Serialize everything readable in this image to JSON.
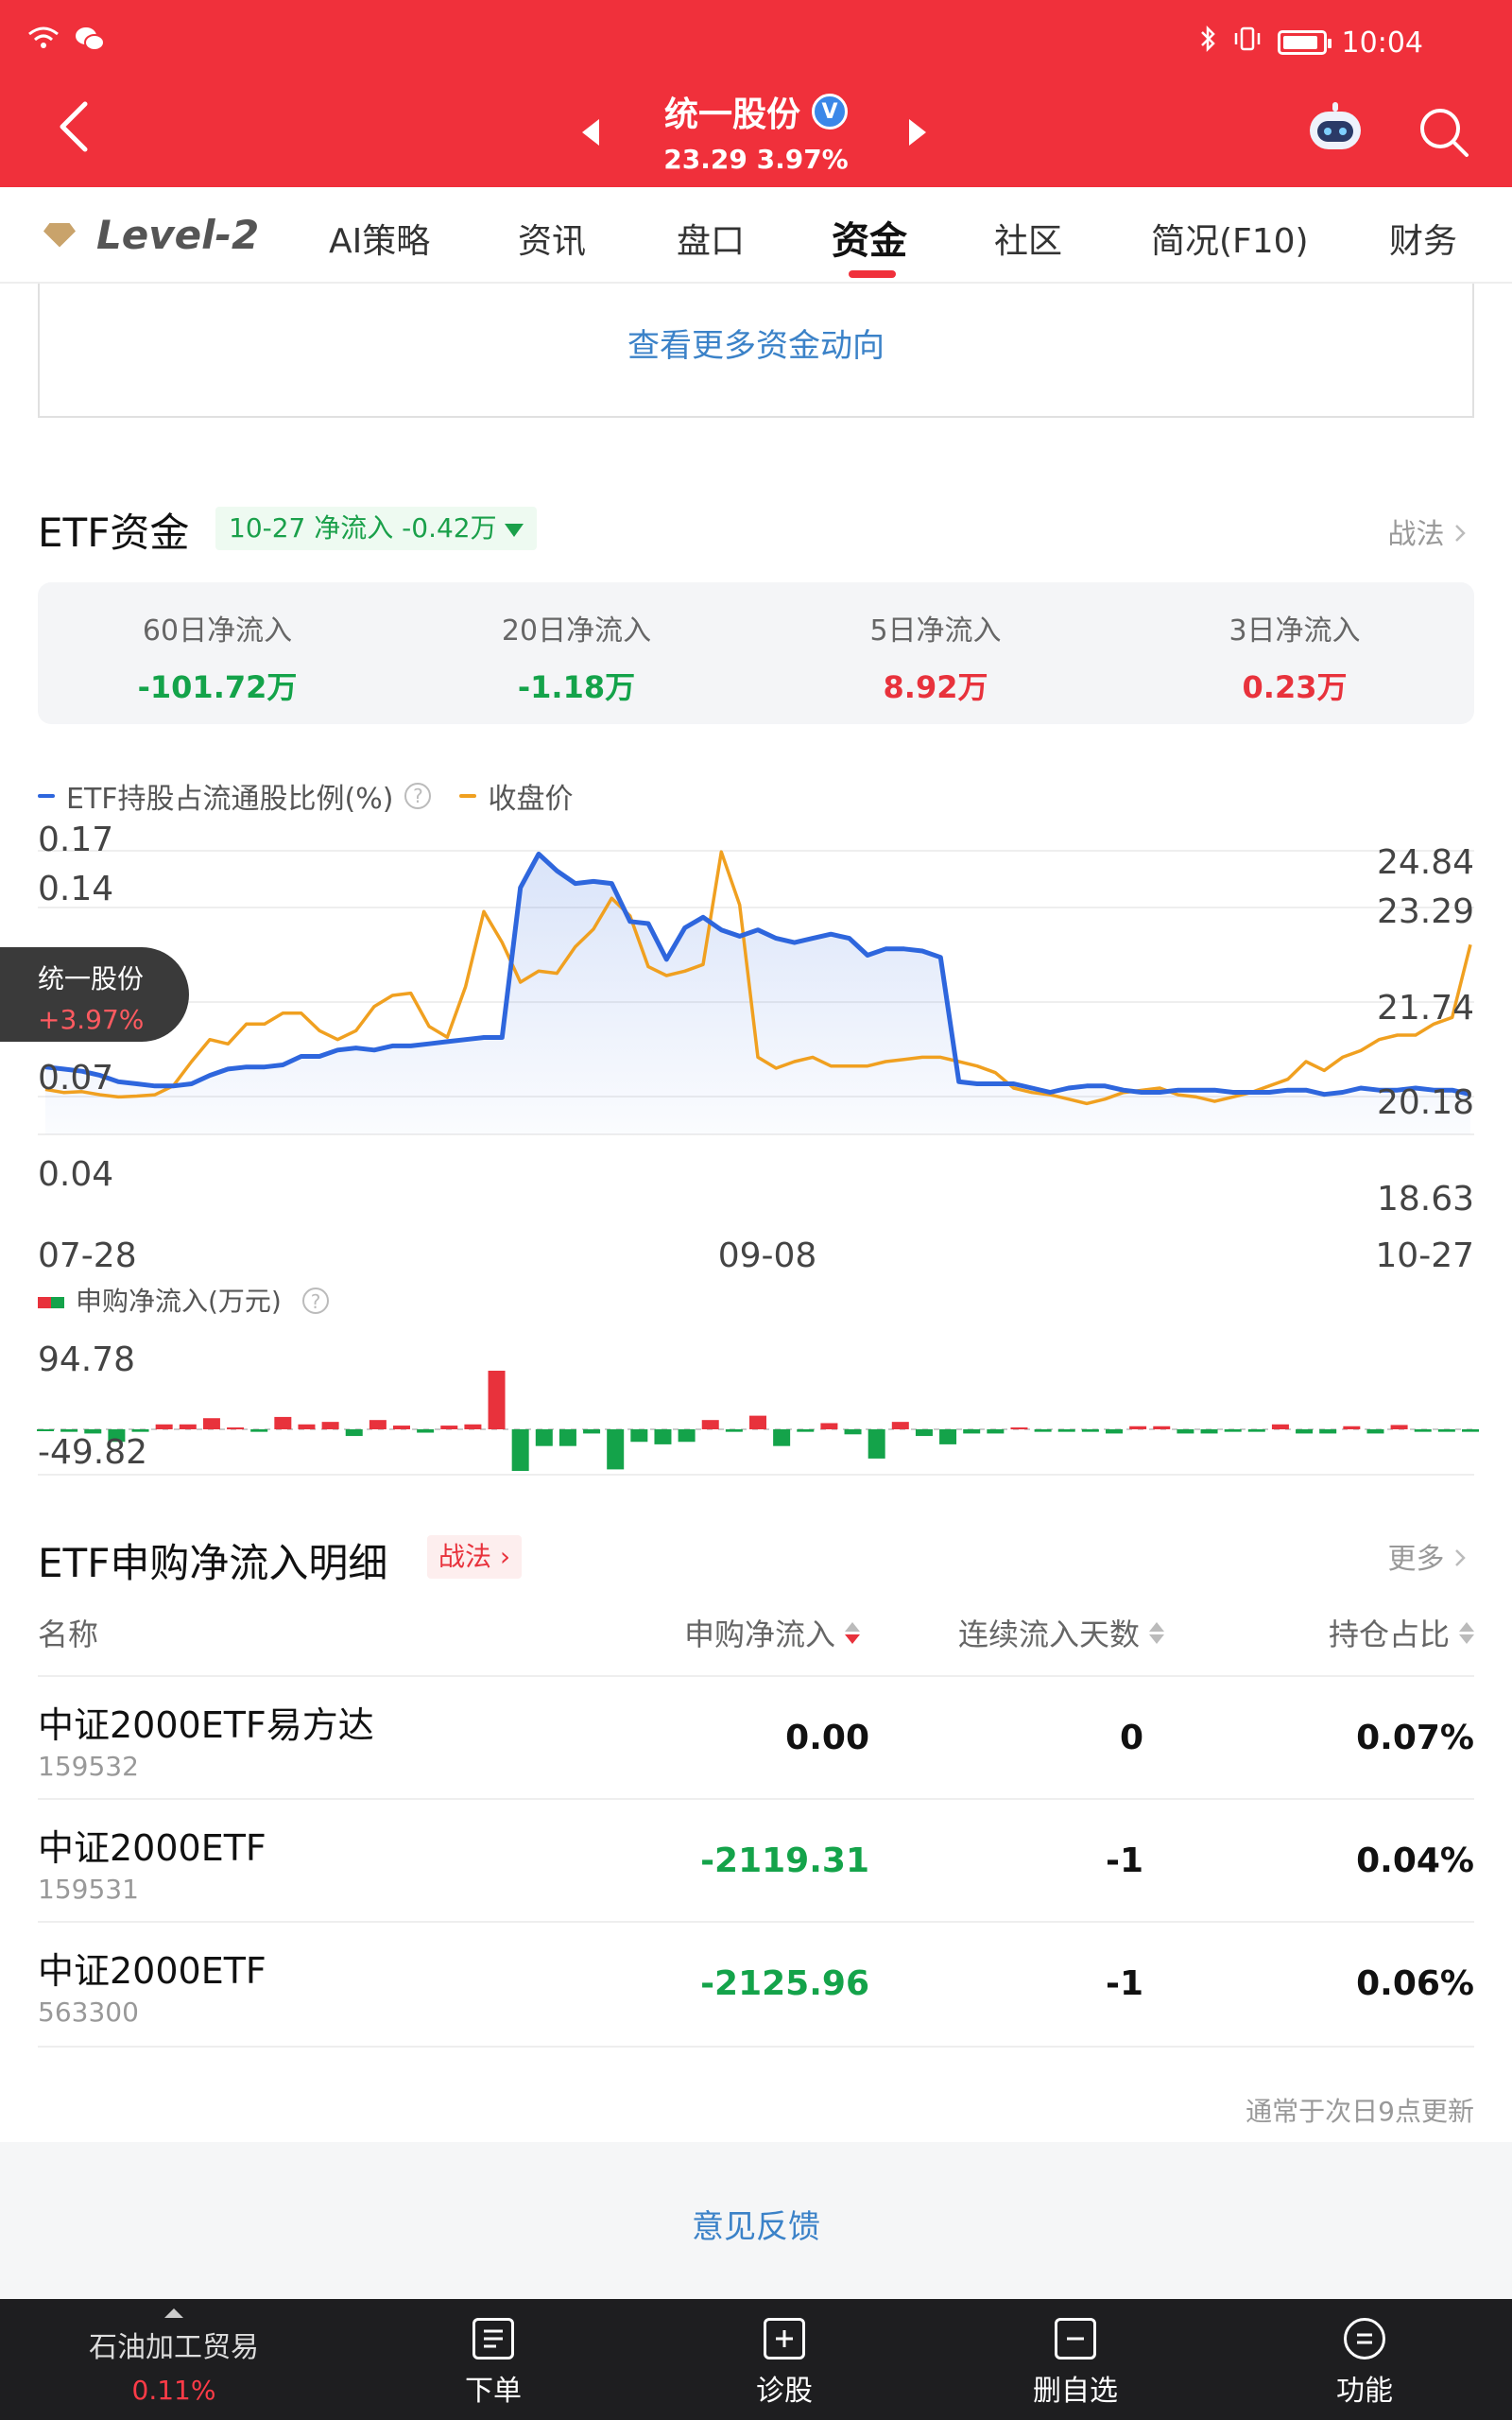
{
  "status": {
    "time": "10:04"
  },
  "header": {
    "title": "统一股份",
    "verified_badge": "V",
    "price": "23.29",
    "change": "3.97%"
  },
  "tabs": [
    {
      "label": "Level-2"
    },
    {
      "label": "AI策略"
    },
    {
      "label": "资讯"
    },
    {
      "label": "盘口"
    },
    {
      "label": "资金",
      "active": true
    },
    {
      "label": "社区"
    },
    {
      "label": "简况(F10)"
    },
    {
      "label": "财务"
    }
  ],
  "top_link": "查看更多资金动向",
  "etf": {
    "title": "ETF资金",
    "tag": "10-27 净流入 -0.42万",
    "strategy_link": "战法",
    "stats": [
      {
        "label": "60日净流入",
        "value": "-101.72万",
        "dir": "down"
      },
      {
        "label": "20日净流入",
        "value": "-1.18万",
        "dir": "down"
      },
      {
        "label": "5日净流入",
        "value": "8.92万",
        "dir": "up"
      },
      {
        "label": "3日净流入",
        "value": "0.23万",
        "dir": "up"
      }
    ]
  },
  "overlay": {
    "name": "统一股份",
    "change": "+3.97%"
  },
  "colors": {
    "brand_red": "#f0303b",
    "up": "#e8323c",
    "down": "#14a34a",
    "blue_series": "#2e66dd",
    "orange_series": "#f0a020",
    "link_blue": "#3b82c8"
  },
  "chart_data": [
    {
      "type": "line",
      "legend": [
        "ETF持股占流通股比例(%)",
        "收盘价"
      ],
      "x_labels": [
        "07-28",
        "09-08",
        "10-27"
      ],
      "y_left_ticks": [
        "0.17",
        "0.14",
        "0.07",
        "0.04"
      ],
      "y_right_ticks": [
        "24.84",
        "23.29",
        "21.74",
        "20.18",
        "18.63"
      ],
      "y_left_range": [
        0.04,
        0.17
      ],
      "y_right_range": [
        18.63,
        24.84
      ],
      "series": [
        {
          "name": "ETF持股占流通股比例(%)",
          "axis": "left",
          "values": [
            0.063,
            0.062,
            0.061,
            0.059,
            0.056,
            0.055,
            0.054,
            0.054,
            0.055,
            0.059,
            0.062,
            0.063,
            0.063,
            0.064,
            0.068,
            0.068,
            0.071,
            0.072,
            0.071,
            0.073,
            0.073,
            0.074,
            0.075,
            0.076,
            0.077,
            0.077,
            0.148,
            0.164,
            0.156,
            0.15,
            0.151,
            0.15,
            0.132,
            0.131,
            0.114,
            0.129,
            0.134,
            0.128,
            0.125,
            0.128,
            0.124,
            0.122,
            0.124,
            0.126,
            0.124,
            0.116,
            0.119,
            0.119,
            0.118,
            0.115,
            0.056,
            0.055,
            0.055,
            0.055,
            0.053,
            0.051,
            0.053,
            0.054,
            0.054,
            0.052,
            0.051,
            0.051,
            0.052,
            0.052,
            0.052,
            0.051,
            0.051,
            0.051,
            0.052,
            0.052,
            0.05,
            0.051,
            0.053,
            0.052,
            0.052,
            0.053,
            0.052,
            0.052,
            0.05
          ]
        },
        {
          "name": "收盘价",
          "axis": "right",
          "values": [
            19.22,
            19.15,
            19.17,
            19.1,
            19.05,
            19.07,
            19.1,
            19.3,
            19.85,
            20.35,
            20.25,
            20.7,
            20.7,
            20.95,
            20.95,
            20.55,
            20.35,
            20.55,
            21.1,
            21.35,
            21.4,
            20.65,
            20.4,
            21.55,
            23.25,
            22.55,
            21.65,
            21.9,
            21.85,
            22.45,
            22.85,
            23.55,
            23.15,
            22.0,
            21.8,
            21.9,
            22.05,
            24.6,
            23.4,
            19.95,
            19.7,
            19.85,
            19.95,
            19.75,
            19.75,
            19.75,
            19.85,
            19.9,
            19.95,
            19.95,
            19.85,
            19.75,
            19.6,
            19.25,
            19.15,
            19.1,
            19.0,
            18.9,
            19.0,
            19.15,
            19.2,
            19.25,
            19.1,
            19.05,
            18.95,
            19.05,
            19.15,
            19.3,
            19.45,
            19.85,
            19.65,
            19.95,
            20.1,
            20.35,
            20.45,
            20.45,
            20.7,
            20.85,
            22.5
          ]
        }
      ]
    },
    {
      "type": "bar",
      "legend": [
        "申购净流入(万元)"
      ],
      "y_ticks": [
        "94.78",
        "-49.82"
      ],
      "y_range": [
        -49.82,
        94.78
      ],
      "values": [
        -2,
        -3,
        -5,
        -15,
        -3,
        8,
        8,
        18,
        3,
        -3,
        20,
        8,
        12,
        -8,
        15,
        6,
        -4,
        6,
        8,
        94.78,
        -49.82,
        -20,
        -20,
        -5,
        -48,
        -15,
        -18,
        -15,
        15,
        -3,
        22,
        -20,
        -3,
        10,
        -6,
        -35,
        12,
        -8,
        -18,
        -5,
        -5,
        3,
        -3,
        -3,
        -3,
        -5,
        5,
        5,
        -5,
        -5,
        -3,
        -3,
        8,
        -5,
        -5,
        5,
        -5,
        7,
        -3,
        -3,
        -3
      ]
    }
  ],
  "detail": {
    "title": "ETF申购净流入明细",
    "strategy_tag": "战法",
    "more": "更多",
    "columns": [
      "名称",
      "申购净流入",
      "连续流入天数",
      "持仓占比"
    ],
    "rows": [
      {
        "name": "中证2000ETF易方达",
        "code": "159532",
        "flow": "0.00",
        "flow_dir": "flat",
        "days": "0",
        "ratio": "0.07%"
      },
      {
        "name": "中证2000ETF",
        "code": "159531",
        "flow": "-2119.31",
        "flow_dir": "down",
        "days": "-1",
        "ratio": "0.04%"
      },
      {
        "name": "中证2000ETF",
        "code": "563300",
        "flow": "-2125.96",
        "flow_dir": "down",
        "days": "-1",
        "ratio": "0.06%"
      }
    ],
    "note": "通常于次日9点更新"
  },
  "feedback": "意见反馈",
  "bottom_bar": {
    "ticker": {
      "label": "石油加工贸易",
      "change": "0.11%"
    },
    "items": [
      {
        "label": "下单",
        "icon": "order-icon"
      },
      {
        "label": "诊股",
        "icon": "diagnose-icon"
      },
      {
        "label": "删自选",
        "icon": "remove-watchlist-icon"
      },
      {
        "label": "功能",
        "icon": "menu-icon"
      }
    ]
  }
}
